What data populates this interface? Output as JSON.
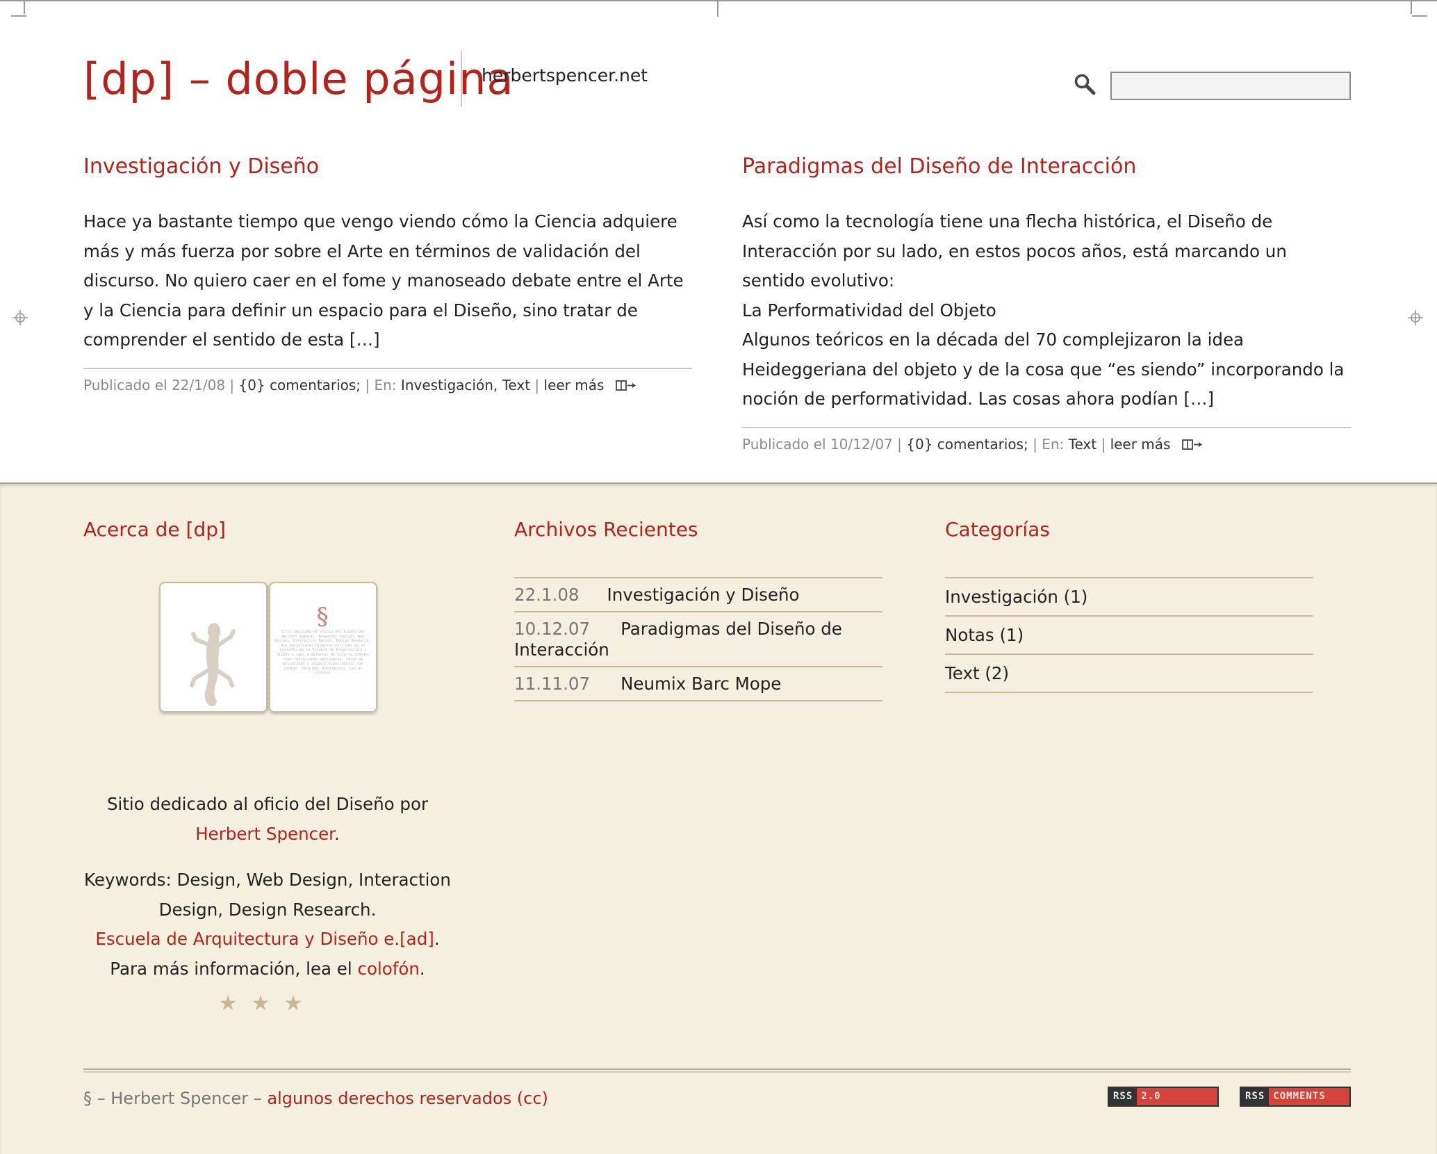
{
  "site": {
    "title": "[dp] – doble página",
    "tagline": "herbertspencer.net"
  },
  "search": {
    "placeholder": "",
    "value": ""
  },
  "posts": [
    {
      "title": "Investigación y Diseño",
      "paragraphs": [
        "Hace ya bastante tiempo que vengo viendo cómo la Ciencia adquiere más y más fuerza por sobre el Arte en términos de validación del discurso. No quiero caer en el fome y manoseado debate entre el Arte y la Ciencia para definir un espacio para el Diseño, sino tratar de comprender el sentido de esta […]"
      ],
      "published": "Publicado el 22/1/08",
      "comments": "{0} comentarios;",
      "in_label": "En:",
      "categories": [
        "Investigación",
        "Text"
      ],
      "read_more": "leer más"
    },
    {
      "title": "Paradigmas del Diseño de Interacción",
      "paragraphs": [
        "Así como la tecnología tiene una flecha histórica, el Diseño de Interacción por su lado, en estos pocos años, está marcando un sentido evolutivo:",
        "La Performatividad del Objeto",
        "Algunos teóricos en la década del 70 complejizaron la idea Heideggeriana del objeto y de la cosa que “es siendo” incorporando la noción de performatividad. Las cosas ahora podían […]"
      ],
      "published": "Publicado el 10/12/07",
      "comments": "{0} comentarios;",
      "in_label": "En:",
      "categories": [
        "Text"
      ],
      "read_more": "leer más"
    }
  ],
  "about": {
    "title": "Acerca de [dp]",
    "line1": "Sitio dedicado al oficio del Diseño por ",
    "author_link": "Herbert Spencer",
    "line1_end": ".",
    "keywords": "Keywords: Design, Web Design, Interaction Design, Design Research.",
    "school_link": "Escuela de Arquitectura y Diseño e.[ad]",
    "more_info": ". Para más información, lea el ",
    "colophon_link": "colofón",
    "more_info_end": ".",
    "stars": "★★★",
    "book_symbol": "§",
    "book_text": "Sitio dedicado al oficio del Diseño por Herbert Spencer. Keywords: Design, Web Design, Interaction Design, Design Research. Aca encontrarás diversos escritos en el contexto de la Escuela de Arquitectura y Diseño e.[ad] y material de diversa índole, como reflexiones personales, cosas de actualidad y algunos experimentos con código. Para más información, lea el colofón."
  },
  "archives": {
    "title": "Archivos Recientes",
    "items": [
      {
        "date": "22.1.08",
        "title": "Investigación y Diseño"
      },
      {
        "date": "10.12.07",
        "title": "Paradigmas del Diseño de Interacción"
      },
      {
        "date": "11.11.07",
        "title": "Neumix Barc Mope"
      }
    ]
  },
  "categories": {
    "title": "Categorías",
    "items": [
      "Investigación (1)",
      "Notas (1)",
      "Text (2)"
    ]
  },
  "footer": {
    "copyright_prefix": "§ – Herbert Spencer – ",
    "copyright_link": "algunos derechos reservados (cc)",
    "badges": [
      {
        "left": "RSS",
        "right": "2.0"
      },
      {
        "left": "RSS",
        "right": "COMMENTS"
      }
    ]
  },
  "colors": {
    "accent": "#b4231b",
    "footer_bg": "#f4efdf",
    "rule": "#c8bd99"
  },
  "icons": [
    "search-icon",
    "read-more-icon",
    "registration-mark-icon",
    "lizard-icon"
  ]
}
